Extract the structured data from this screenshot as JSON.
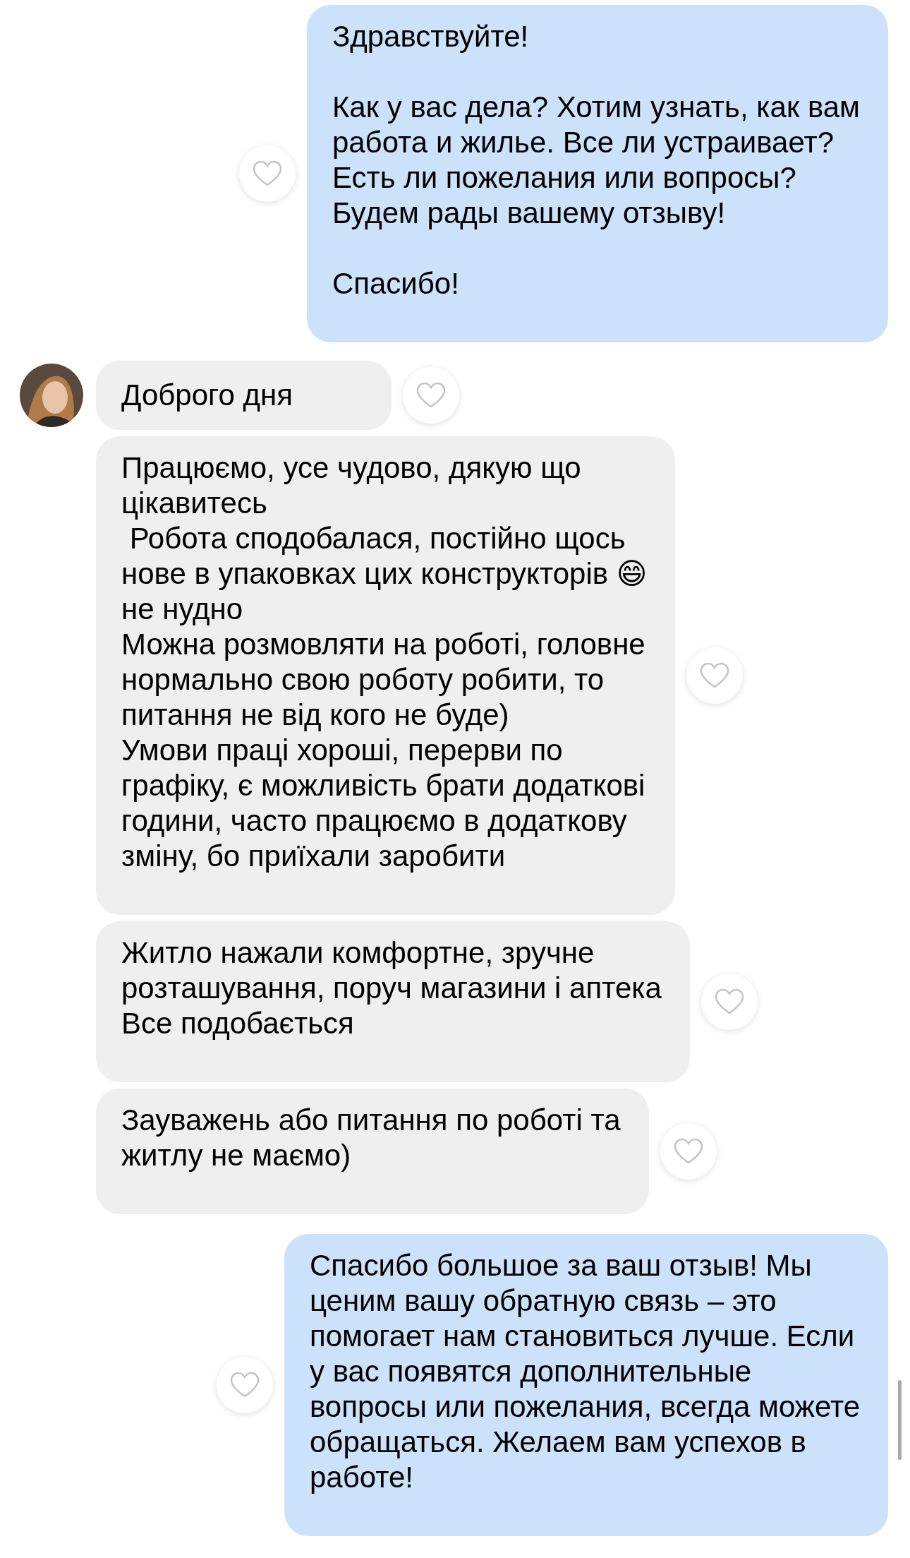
{
  "messages": [
    {
      "kind": "outgoing",
      "show_avatar": false,
      "text": "Здравствуйте!\n\nКак у вас дела? Хотим узнать, как вам\nработа и жилье. Все ли устраивает?\nЕсть ли пожелания или вопросы?\nБудем рады вашему отзыву!\n\nСпасибо!"
    },
    {
      "kind": "incoming",
      "show_avatar": true,
      "text": "Доброго дня"
    },
    {
      "kind": "incoming",
      "show_avatar": false,
      "text": "Працюємо, усе чудово, дякую що\nцікавитесь\n Робота сподобалася, постійно щось\nнове в упаковках цих конструкторів 😄\nне нудно\nМожна розмовляти на роботі, головне\nнормально свою роботу робити, то\nпитання не від кого не буде)\nУмови праці хороші, перерви по\nграфіку, є можливість брати додаткові\nгодини, часто працюємо в додаткову\nзміну, бо приїхали заробити"
    },
    {
      "kind": "incoming",
      "show_avatar": false,
      "text": "Житло нажали комфортне, зручне\nрозташування, поруч магазини і аптека\nВсе подобається"
    },
    {
      "kind": "incoming",
      "show_avatar": false,
      "text": "Зауважень або питання по роботі та\nжитлу не маємо)"
    },
    {
      "kind": "outgoing",
      "show_avatar": false,
      "text": "Спасибо большое за ваш отзыв! Мы\nценим вашу обратную связь – это\nпомогает нам становиться лучше. Если\nу вас появятся дополнительные\nвопросы или пожелания, всегда можете\nобращаться. Желаем вам успехов в\nработе!"
    }
  ]
}
